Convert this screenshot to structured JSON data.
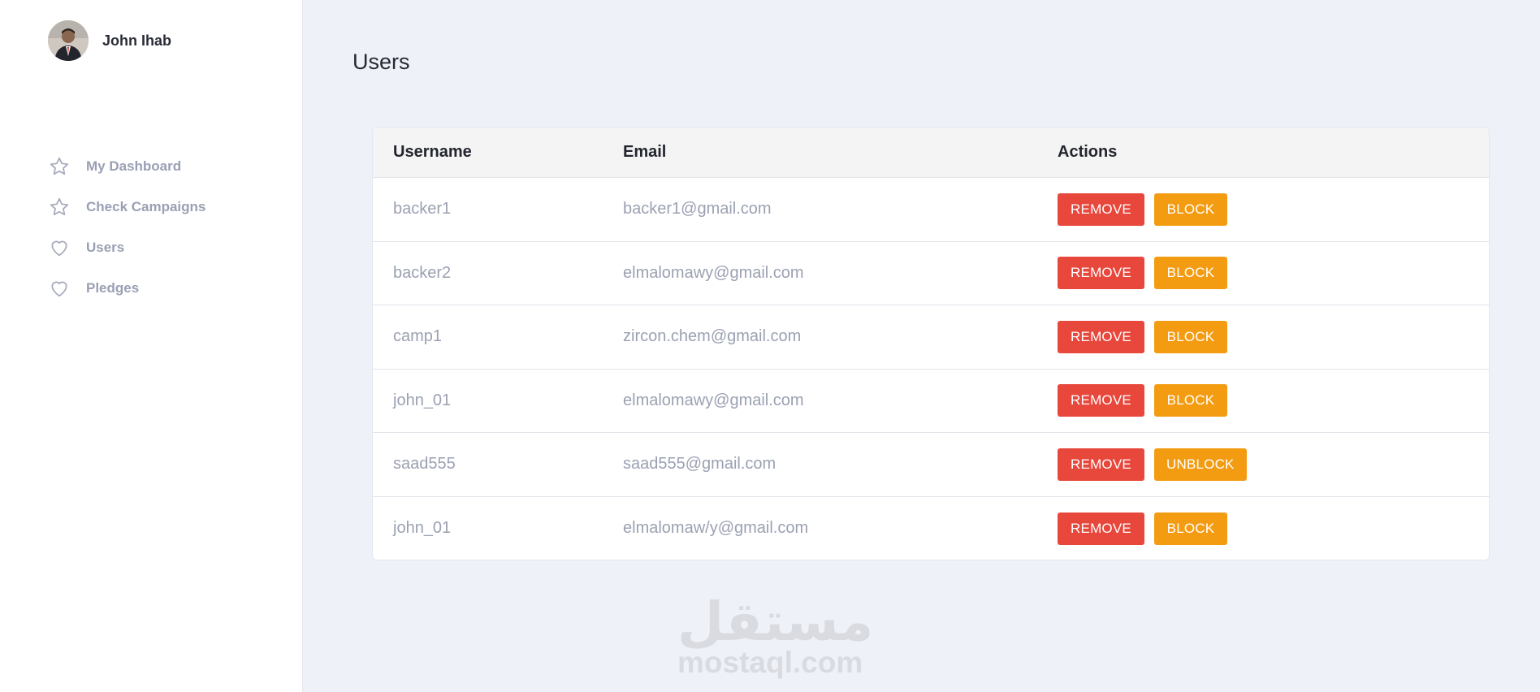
{
  "sidebar": {
    "profile": {
      "name": "John Ihab"
    },
    "items": [
      {
        "label": "My Dashboard",
        "icon": "star-icon"
      },
      {
        "label": "Check Campaigns",
        "icon": "star-icon"
      },
      {
        "label": "Users",
        "icon": "heart-icon"
      },
      {
        "label": "Pledges",
        "icon": "heart-icon"
      }
    ]
  },
  "main": {
    "title": "Users",
    "table": {
      "headers": {
        "username": "Username",
        "email": "Email",
        "actions": "Actions"
      },
      "rows": [
        {
          "username": "backer1",
          "email": "backer1@gmail.com",
          "remove": "REMOVE",
          "toggle": "BLOCK"
        },
        {
          "username": "backer2",
          "email": "elmalomawy@gmail.com",
          "remove": "REMOVE",
          "toggle": "BLOCK"
        },
        {
          "username": "camp1",
          "email": "zircon.chem@gmail.com",
          "remove": "REMOVE",
          "toggle": "BLOCK"
        },
        {
          "username": "john_01",
          "email": "elmalomawy@gmail.com",
          "remove": "REMOVE",
          "toggle": "BLOCK"
        },
        {
          "username": "saad555",
          "email": "saad555@gmail.com",
          "remove": "REMOVE",
          "toggle": "UNBLOCK"
        },
        {
          "username": "john_01",
          "email": "elmalomaw/y@gmail.com",
          "remove": "REMOVE",
          "toggle": "BLOCK"
        }
      ]
    }
  },
  "watermark": {
    "arabic": "مستقل",
    "latin": "mostaql.com"
  },
  "colors": {
    "remove": "#e8473b",
    "block": "#f39c12",
    "background": "#eef1f8"
  }
}
